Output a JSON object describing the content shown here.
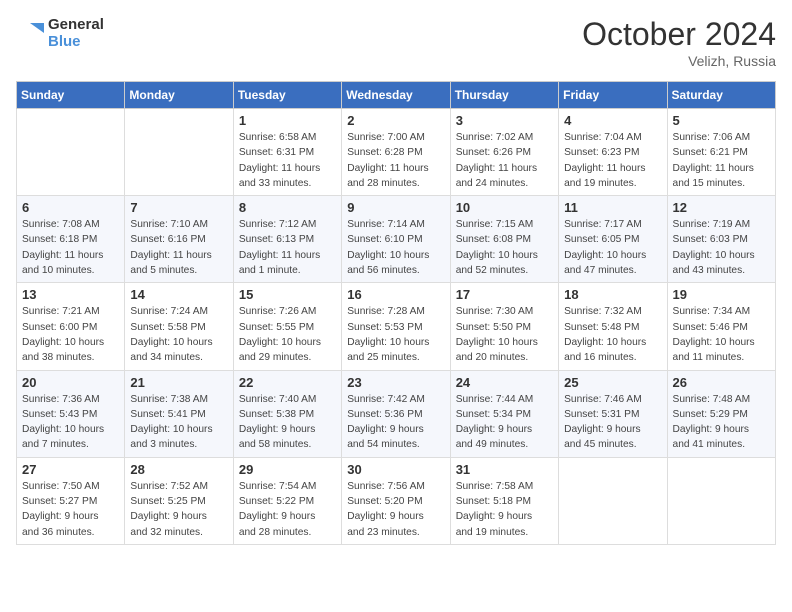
{
  "logo": {
    "text_general": "General",
    "text_blue": "Blue"
  },
  "title": "October 2024",
  "location": "Velizh, Russia",
  "days_of_week": [
    "Sunday",
    "Monday",
    "Tuesday",
    "Wednesday",
    "Thursday",
    "Friday",
    "Saturday"
  ],
  "weeks": [
    [
      {
        "num": "",
        "info": ""
      },
      {
        "num": "",
        "info": ""
      },
      {
        "num": "1",
        "info": "Sunrise: 6:58 AM\nSunset: 6:31 PM\nDaylight: 11 hours\nand 33 minutes."
      },
      {
        "num": "2",
        "info": "Sunrise: 7:00 AM\nSunset: 6:28 PM\nDaylight: 11 hours\nand 28 minutes."
      },
      {
        "num": "3",
        "info": "Sunrise: 7:02 AM\nSunset: 6:26 PM\nDaylight: 11 hours\nand 24 minutes."
      },
      {
        "num": "4",
        "info": "Sunrise: 7:04 AM\nSunset: 6:23 PM\nDaylight: 11 hours\nand 19 minutes."
      },
      {
        "num": "5",
        "info": "Sunrise: 7:06 AM\nSunset: 6:21 PM\nDaylight: 11 hours\nand 15 minutes."
      }
    ],
    [
      {
        "num": "6",
        "info": "Sunrise: 7:08 AM\nSunset: 6:18 PM\nDaylight: 11 hours\nand 10 minutes."
      },
      {
        "num": "7",
        "info": "Sunrise: 7:10 AM\nSunset: 6:16 PM\nDaylight: 11 hours\nand 5 minutes."
      },
      {
        "num": "8",
        "info": "Sunrise: 7:12 AM\nSunset: 6:13 PM\nDaylight: 11 hours\nand 1 minute."
      },
      {
        "num": "9",
        "info": "Sunrise: 7:14 AM\nSunset: 6:10 PM\nDaylight: 10 hours\nand 56 minutes."
      },
      {
        "num": "10",
        "info": "Sunrise: 7:15 AM\nSunset: 6:08 PM\nDaylight: 10 hours\nand 52 minutes."
      },
      {
        "num": "11",
        "info": "Sunrise: 7:17 AM\nSunset: 6:05 PM\nDaylight: 10 hours\nand 47 minutes."
      },
      {
        "num": "12",
        "info": "Sunrise: 7:19 AM\nSunset: 6:03 PM\nDaylight: 10 hours\nand 43 minutes."
      }
    ],
    [
      {
        "num": "13",
        "info": "Sunrise: 7:21 AM\nSunset: 6:00 PM\nDaylight: 10 hours\nand 38 minutes."
      },
      {
        "num": "14",
        "info": "Sunrise: 7:24 AM\nSunset: 5:58 PM\nDaylight: 10 hours\nand 34 minutes."
      },
      {
        "num": "15",
        "info": "Sunrise: 7:26 AM\nSunset: 5:55 PM\nDaylight: 10 hours\nand 29 minutes."
      },
      {
        "num": "16",
        "info": "Sunrise: 7:28 AM\nSunset: 5:53 PM\nDaylight: 10 hours\nand 25 minutes."
      },
      {
        "num": "17",
        "info": "Sunrise: 7:30 AM\nSunset: 5:50 PM\nDaylight: 10 hours\nand 20 minutes."
      },
      {
        "num": "18",
        "info": "Sunrise: 7:32 AM\nSunset: 5:48 PM\nDaylight: 10 hours\nand 16 minutes."
      },
      {
        "num": "19",
        "info": "Sunrise: 7:34 AM\nSunset: 5:46 PM\nDaylight: 10 hours\nand 11 minutes."
      }
    ],
    [
      {
        "num": "20",
        "info": "Sunrise: 7:36 AM\nSunset: 5:43 PM\nDaylight: 10 hours\nand 7 minutes."
      },
      {
        "num": "21",
        "info": "Sunrise: 7:38 AM\nSunset: 5:41 PM\nDaylight: 10 hours\nand 3 minutes."
      },
      {
        "num": "22",
        "info": "Sunrise: 7:40 AM\nSunset: 5:38 PM\nDaylight: 9 hours\nand 58 minutes."
      },
      {
        "num": "23",
        "info": "Sunrise: 7:42 AM\nSunset: 5:36 PM\nDaylight: 9 hours\nand 54 minutes."
      },
      {
        "num": "24",
        "info": "Sunrise: 7:44 AM\nSunset: 5:34 PM\nDaylight: 9 hours\nand 49 minutes."
      },
      {
        "num": "25",
        "info": "Sunrise: 7:46 AM\nSunset: 5:31 PM\nDaylight: 9 hours\nand 45 minutes."
      },
      {
        "num": "26",
        "info": "Sunrise: 7:48 AM\nSunset: 5:29 PM\nDaylight: 9 hours\nand 41 minutes."
      }
    ],
    [
      {
        "num": "27",
        "info": "Sunrise: 7:50 AM\nSunset: 5:27 PM\nDaylight: 9 hours\nand 36 minutes."
      },
      {
        "num": "28",
        "info": "Sunrise: 7:52 AM\nSunset: 5:25 PM\nDaylight: 9 hours\nand 32 minutes."
      },
      {
        "num": "29",
        "info": "Sunrise: 7:54 AM\nSunset: 5:22 PM\nDaylight: 9 hours\nand 28 minutes."
      },
      {
        "num": "30",
        "info": "Sunrise: 7:56 AM\nSunset: 5:20 PM\nDaylight: 9 hours\nand 23 minutes."
      },
      {
        "num": "31",
        "info": "Sunrise: 7:58 AM\nSunset: 5:18 PM\nDaylight: 9 hours\nand 19 minutes."
      },
      {
        "num": "",
        "info": ""
      },
      {
        "num": "",
        "info": ""
      }
    ]
  ]
}
